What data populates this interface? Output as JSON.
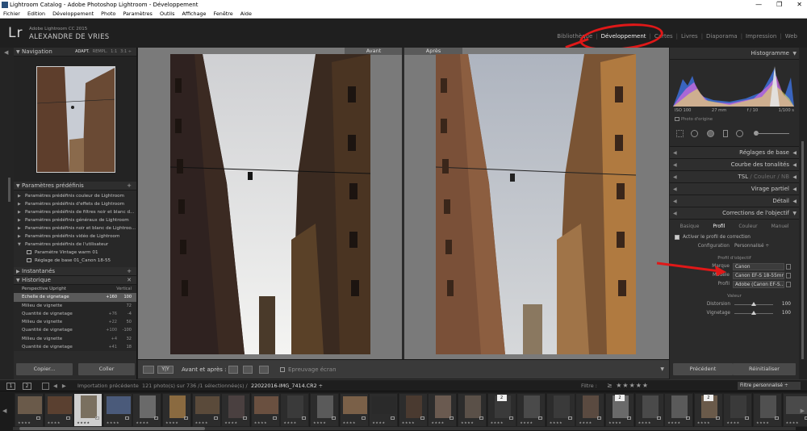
{
  "window": {
    "title": "Lightroom Catalog - Adobe Photoshop Lightroom - Développement",
    "controls": [
      "—",
      "❐",
      "✕"
    ]
  },
  "menu": [
    "Fichier",
    "Edition",
    "Développement",
    "Photo",
    "Paramètres",
    "Outils",
    "Affichage",
    "Fenêtre",
    "Aide"
  ],
  "identity": {
    "logo": "Lr",
    "product": "Adobe Lightroom CC 2015",
    "user": "ALEXANDRE DE VRIES"
  },
  "modules": [
    {
      "label": "Bibliothèque",
      "active": false
    },
    {
      "label": "Développement",
      "active": true
    },
    {
      "label": "Cartes",
      "active": false
    },
    {
      "label": "Livres",
      "active": false
    },
    {
      "label": "Diaporama",
      "active": false
    },
    {
      "label": "Impression",
      "active": false
    },
    {
      "label": "Web",
      "active": false
    }
  ],
  "navigator": {
    "title": "Navigation",
    "zoom": [
      "ADAPT.",
      "REMPL.",
      "1:1",
      "3:1 ÷"
    ]
  },
  "presets": {
    "title": "Paramètres prédéfinis",
    "items": [
      "Paramètres prédéfinis couleur de Lightroom",
      "Paramètres prédéfinis d'effets de Lightroom",
      "Paramètres prédéfinis de filtres noir et blanc d...",
      "Paramètres prédéfinis généraux de Lightroom",
      "Paramètres prédéfinis noir et blanc de Lightroo...",
      "Paramètres prédéfinis vidéo de Lightroom",
      "Paramètres prédéfinis de l'utilisateur"
    ],
    "subitems": [
      "Paramètre Vintage warm 01",
      "Réglage de base 01_Canon 18-55"
    ]
  },
  "snapshots": {
    "title": "Instantanés"
  },
  "history": {
    "title": "Historique",
    "rows": [
      {
        "label": "Perspective Upright",
        "a": "",
        "b": "Vertical",
        "hl": false
      },
      {
        "label": "Echelle de vignetage",
        "a": "+160",
        "b": "100",
        "hl": true
      },
      {
        "label": "Milieu de vignette",
        "a": "",
        "b": "72",
        "hl": false
      },
      {
        "label": "Quantité de vignetage",
        "a": "+76",
        "b": "-4",
        "hl": false
      },
      {
        "label": "Milieu de vignette",
        "a": "+22",
        "b": "50",
        "hl": false
      },
      {
        "label": "Quantité de vignetage",
        "a": "+100",
        "b": "-100",
        "hl": false
      },
      {
        "label": "Milieu de vignette",
        "a": "+4",
        "b": "32",
        "hl": false
      },
      {
        "label": "Quantité de vignetage",
        "a": "+41",
        "b": "18",
        "hl": false
      }
    ]
  },
  "left_buttons": {
    "copy": "Copier...",
    "paste": "Coller"
  },
  "view": {
    "before": "Avant",
    "after": "Après"
  },
  "toolbar": {
    "before_after": "Avant et après :",
    "proof": "Epreuvage écran",
    "yy": "Y|Y"
  },
  "right_panels": {
    "histogram": "Histogramme",
    "basic": "Réglages de base",
    "tone_curve": "Courbe des tonalités",
    "hsl": [
      "TSL",
      "Couleur",
      "NB"
    ],
    "split": "Virage partiel",
    "detail": "Détail",
    "lens": "Corrections de l'objectif"
  },
  "histogram_info": {
    "iso": "ISO 100",
    "focal": "27 mm",
    "aperture": "f / 10",
    "shutter": "1/100 s",
    "original": "Photo d'origine"
  },
  "lens": {
    "tabs": [
      {
        "label": "Basique",
        "active": false
      },
      {
        "label": "Profil",
        "active": true
      },
      {
        "label": "Couleur",
        "active": false
      },
      {
        "label": "Manuel",
        "active": false
      }
    ],
    "enable": "Activer le profil de correction",
    "config_label": "Configuration",
    "config_value": "Personnalisé ÷",
    "profile_section": "Profil d'objectif",
    "make_label": "Marque",
    "make_value": "Canon",
    "model_label": "Modèle",
    "model_value": "Canon EF-S 18-55mm...",
    "profile_label": "Profil",
    "profile_value": "Adobe (Canon EF-S...",
    "amount_section": "Valeur",
    "distortion_label": "Distorsion",
    "distortion_value": 100,
    "vignetting_label": "Vignetage",
    "vignetting_value": 100
  },
  "right_buttons": {
    "prev": "Précédent",
    "reset": "Réinitialiser"
  },
  "filmbar": {
    "pages": [
      "1",
      "2"
    ],
    "source": "Importation précédente",
    "count": "121 photo(s) sur 736 /1 sélectionnée(s) /",
    "file": "22022016-IMG_7414.CR2 ÷",
    "filter_label": "Filtre :",
    "stars": "≥ ★★★★★",
    "filter_value": "Filtre personnalisé ÷"
  },
  "colors": {
    "accent_red": "#e01818",
    "panel": "#2b2b2b",
    "canvas": "#7a7a7a"
  }
}
